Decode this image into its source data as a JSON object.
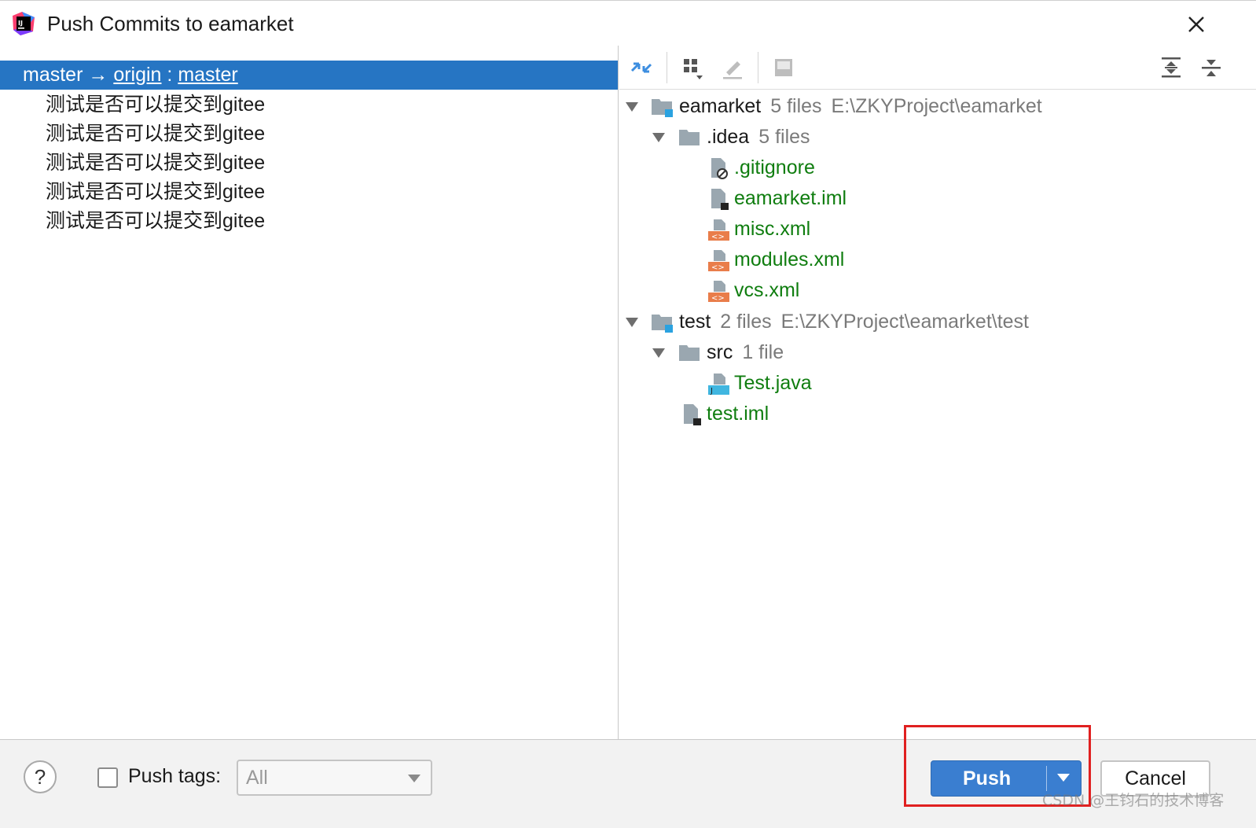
{
  "window": {
    "title": "Push Commits to eamarket",
    "app_icon": "intellij-idea-icon",
    "close_icon": "close-icon"
  },
  "commits_panel": {
    "branch_row": {
      "local": "master",
      "arrow": "→",
      "remote": "origin",
      "separator": ":",
      "remote_branch": "master"
    },
    "commits": [
      "测试是否可以提交到gitee",
      "测试是否可以提交到gitee",
      "测试是否可以提交到gitee",
      "测试是否可以提交到gitee",
      "测试是否可以提交到gitee"
    ]
  },
  "files_panel": {
    "toolbar": {
      "icons": [
        "diff-compare-icon",
        "group-by-icon",
        "edit-source-icon",
        "preview-icon",
        "expand-all-icon",
        "collapse-all-icon"
      ]
    },
    "tree": {
      "eamarket": {
        "name": "eamarket",
        "count": "5 files",
        "path": "E:\\ZKYProject\\eamarket"
      },
      "idea": {
        "name": ".idea",
        "count": "5 files"
      },
      "gitignore": ".gitignore",
      "eamarket_iml": "eamarket.iml",
      "misc_xml": "misc.xml",
      "modules_xml": "modules.xml",
      "vcs_xml": "vcs.xml",
      "test": {
        "name": "test",
        "count": "2 files",
        "path": "E:\\ZKYProject\\eamarket\\test"
      },
      "src": {
        "name": "src",
        "count": "1 file"
      },
      "test_java": "Test.java",
      "test_iml": "test.iml"
    },
    "colors": {
      "added_file": "#0f7d0f",
      "selection": "#2675c3"
    }
  },
  "footer": {
    "help_label": "?",
    "push_tags_label": "Push tags:",
    "push_tags_checked": false,
    "tags_select_value": "All",
    "push_label": "Push",
    "cancel_label": "Cancel",
    "primary_color": "#3a7ed0"
  },
  "watermark": "CSDN @王钧石的技术博客"
}
